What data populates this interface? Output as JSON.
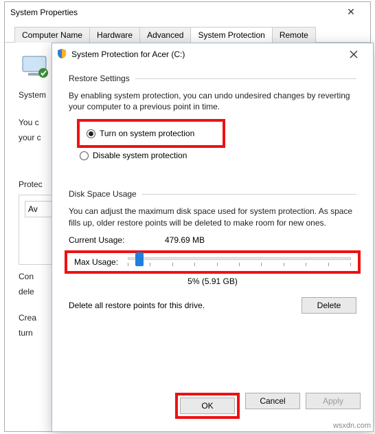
{
  "bg": {
    "title": "System Properties",
    "tabs": [
      "Computer Name",
      "Hardware",
      "Advanced",
      "System Protection",
      "Remote"
    ],
    "heading": "System",
    "line1": "You c",
    "line2": "your c",
    "section": "Protec",
    "col": "Av",
    "l1": "Con",
    "l2": "dele",
    "l3": "Crea",
    "l4": "turn"
  },
  "dlg": {
    "title": "System Protection for Acer (C:)",
    "restore": {
      "header": "Restore Settings",
      "desc": "By enabling system protection, you can undo undesired changes by reverting your computer to a previous point in time.",
      "opt_on": "Turn on system protection",
      "opt_off": "Disable system protection"
    },
    "disk": {
      "header": "Disk Space Usage",
      "desc": "You can adjust the maximum disk space used for system protection. As space fills up, older restore points will be deleted to make room for new ones.",
      "current_lbl": "Current Usage:",
      "current_val": "479.69 MB",
      "max_lbl": "Max Usage:",
      "max_val": "5% (5.91 GB)"
    },
    "delete": {
      "desc": "Delete all restore points for this drive.",
      "btn": "Delete"
    },
    "buttons": {
      "ok": "OK",
      "cancel": "Cancel",
      "apply": "Apply"
    }
  },
  "watermark": "wsxdn.com"
}
